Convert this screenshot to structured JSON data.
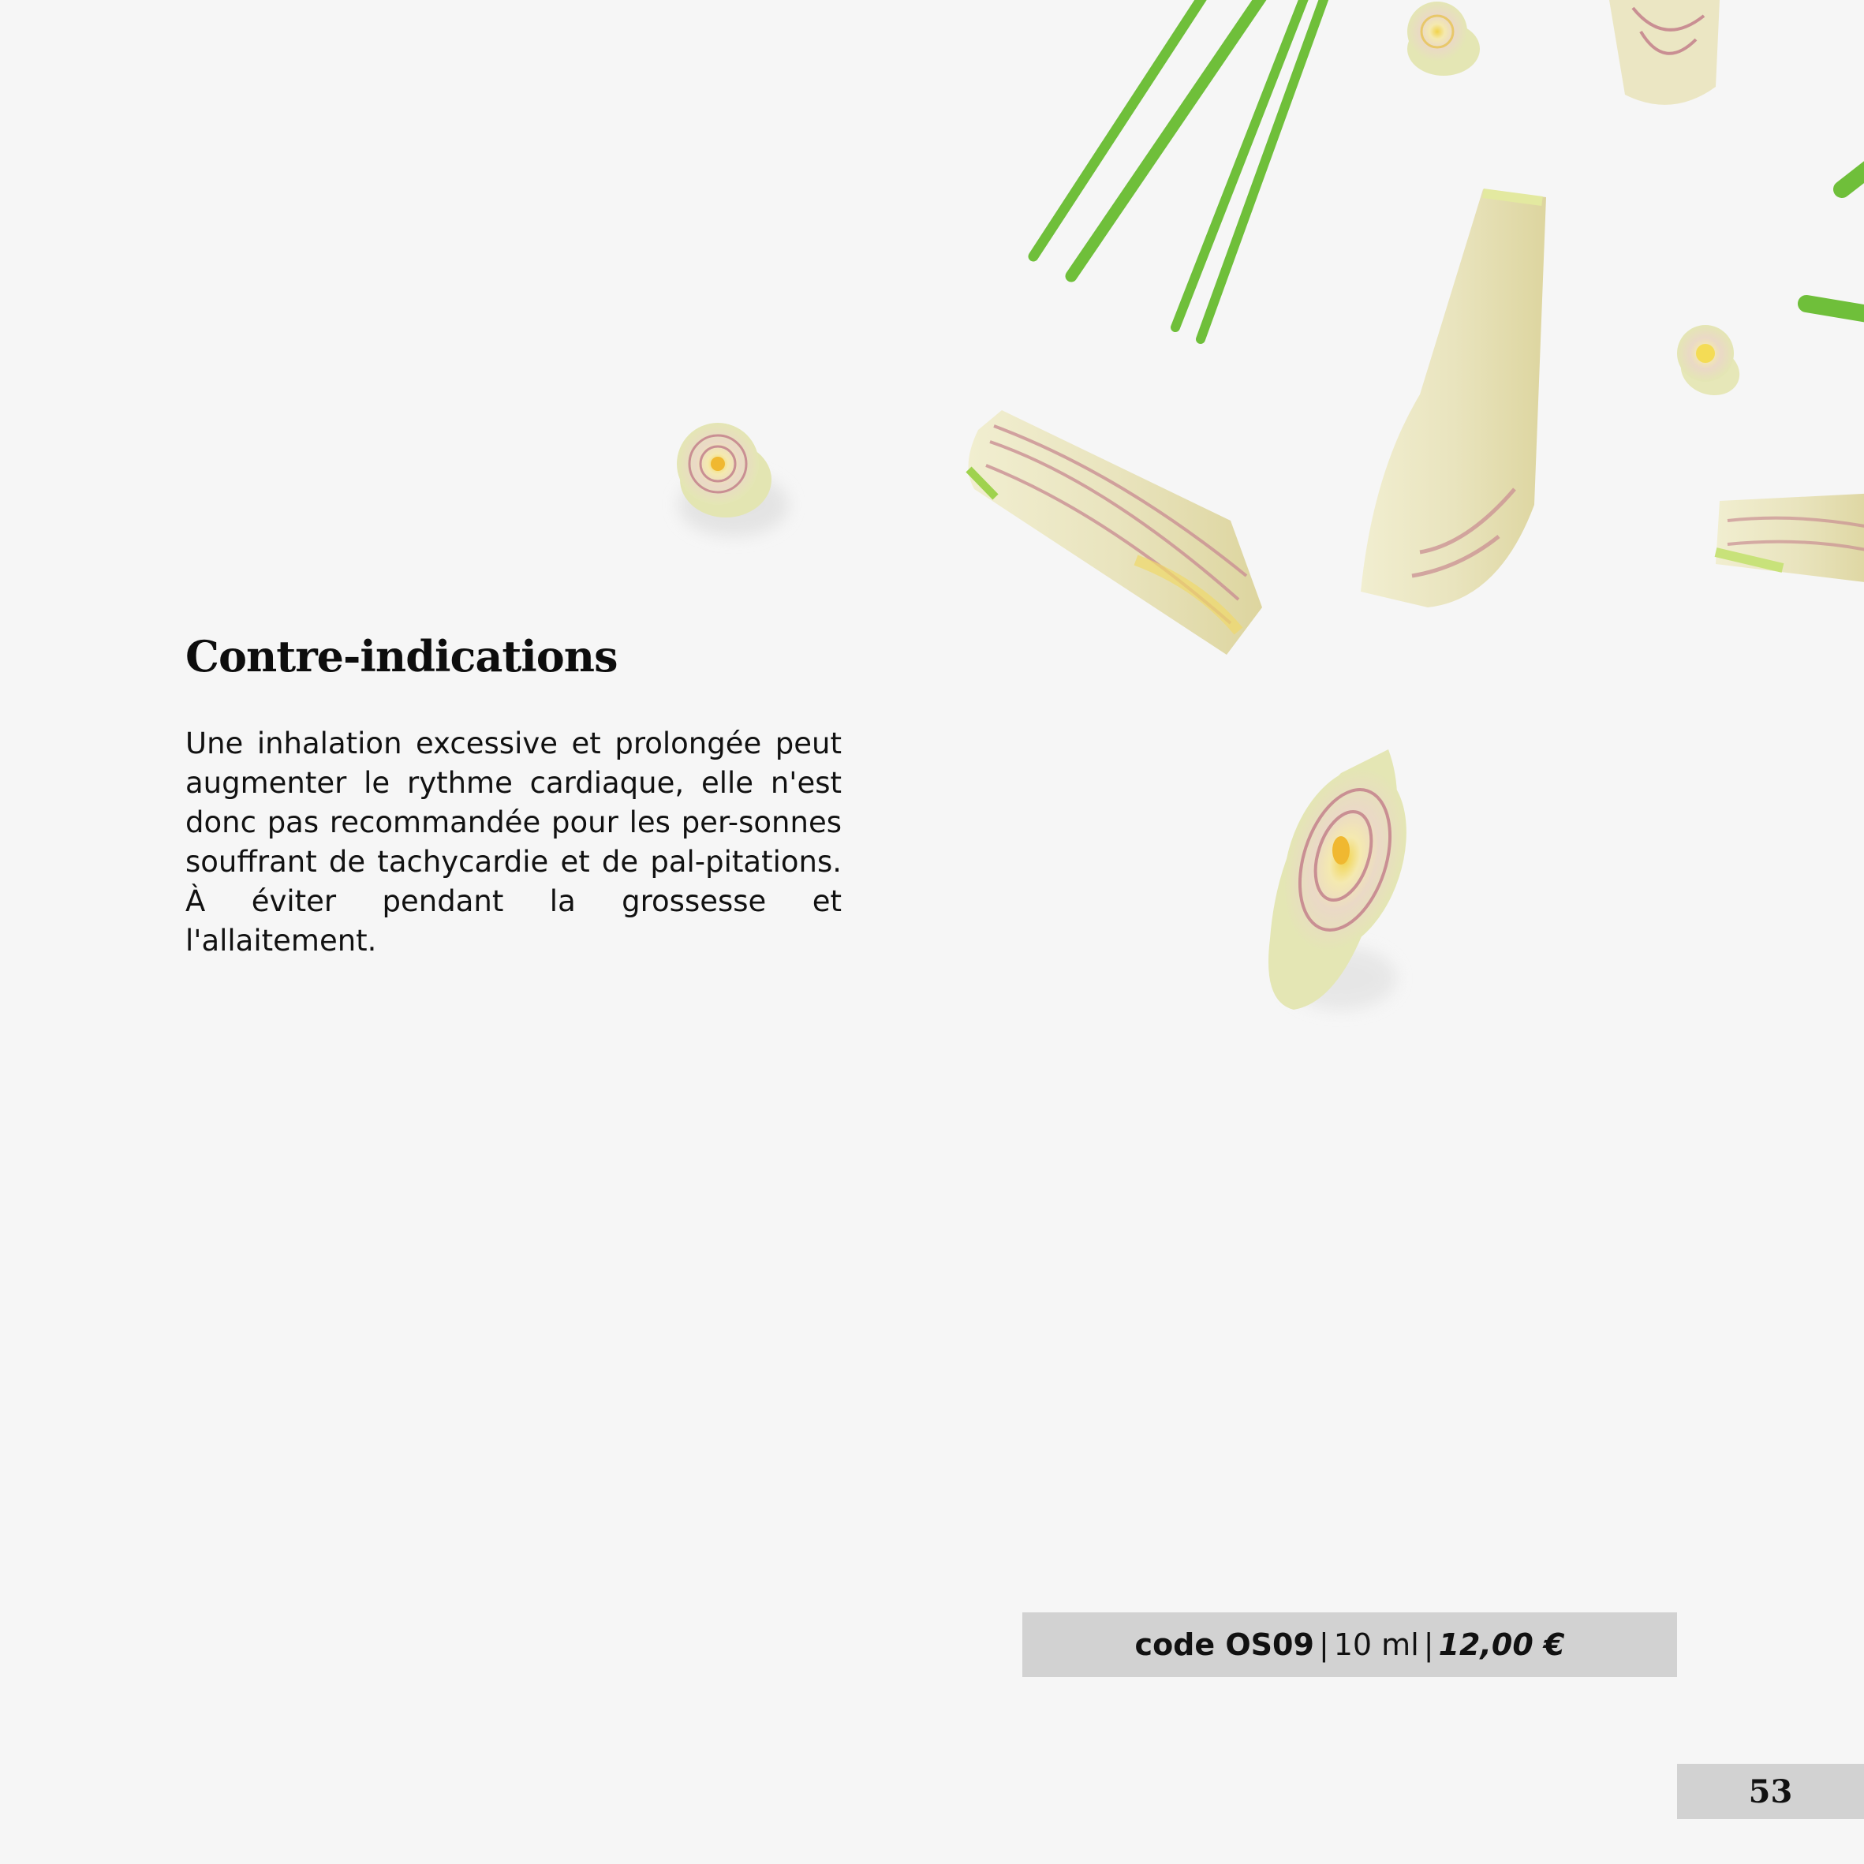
{
  "section": {
    "heading": "Contre-indications",
    "body": "Une inhalation excessive et prolongée peut augmenter le rythme cardiaque, elle n'est donc pas recommandée pour les per-sonnes souffrant de tachycardie et de pal-pitations. À éviter pendant la grossesse et l'allaitement."
  },
  "product": {
    "code": "code OS09",
    "separator": "|",
    "volume": "10 ml",
    "price": "12,00 €"
  },
  "page_number": "53",
  "colors": {
    "background": "#f6f6f6",
    "bar": "#d2d2d2",
    "stalk_green": "#72c23a",
    "stalk_cream": "#ece8bf",
    "ring_pink": "#c98f93"
  }
}
